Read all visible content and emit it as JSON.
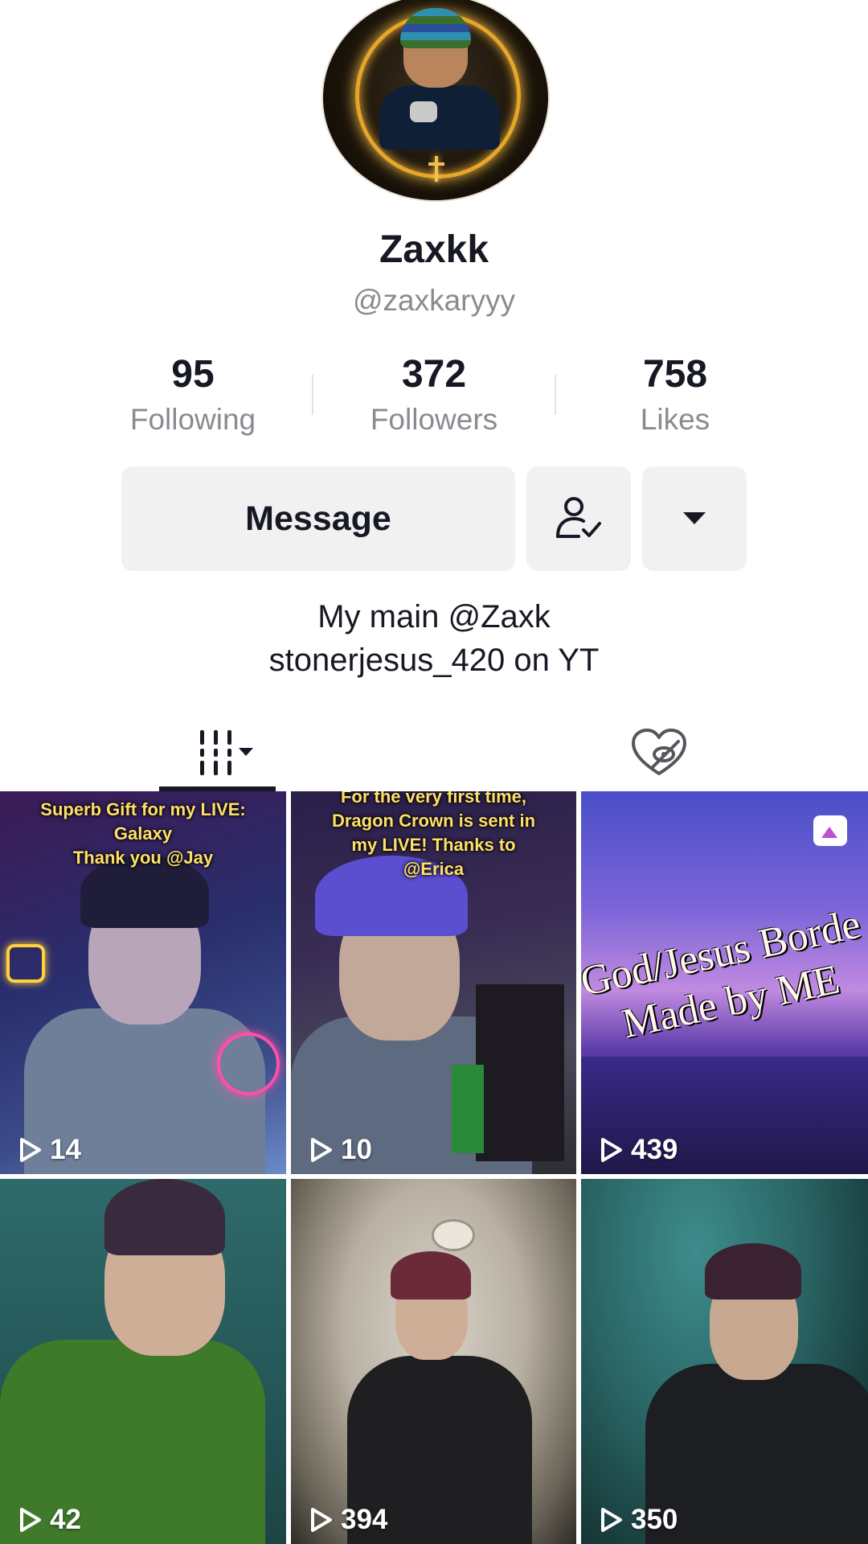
{
  "profile": {
    "display_name": "Zaxkk",
    "username": "@zaxkaryyy",
    "bio_line1": "My main @Zaxk",
    "bio_line2": "stonerjesus_420 on YT"
  },
  "stats": [
    {
      "value": "95",
      "label": "Following"
    },
    {
      "value": "372",
      "label": "Followers"
    },
    {
      "value": "758",
      "label": "Likes"
    }
  ],
  "actions": {
    "message_label": "Message",
    "friend_icon": "person-check-icon",
    "more_icon": "caret-down-icon"
  },
  "tabs": {
    "videos_icon": "grid-lines-icon",
    "liked_icon": "hidden-heart-icon"
  },
  "videos": [
    {
      "views": "14",
      "caption": "Superb Gift for my LIVE:\nGalaxy\nThank you @Jay"
    },
    {
      "views": "10",
      "caption": "For the very first time,\nDragon Crown is sent in\nmy LIVE! Thanks to\n@Erica"
    },
    {
      "views": "439",
      "overlay": "God/Jesus Borde\nMade by ME",
      "badge": "photo-icon"
    },
    {
      "views": "42"
    },
    {
      "views": "394"
    },
    {
      "views": "350"
    }
  ]
}
